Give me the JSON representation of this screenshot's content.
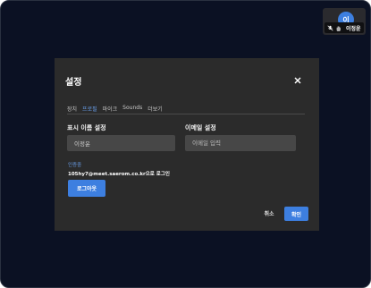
{
  "participant": {
    "initials": "이",
    "name": "이정윤",
    "mic_icon": "mic-muted-icon",
    "hand_icon": "raise-hand-icon"
  },
  "dialog": {
    "title": "설정",
    "close_icon": "close-icon",
    "tabs": [
      {
        "label": "장치",
        "active": false
      },
      {
        "label": "프로필",
        "active": true
      },
      {
        "label": "마이크",
        "active": false
      },
      {
        "label": "Sounds",
        "active": false
      },
      {
        "label": "더보기",
        "active": false
      }
    ],
    "display_name": {
      "label": "표시 이름 설정",
      "value": "이정윤"
    },
    "email": {
      "label": "이메일 설정",
      "placeholder": "이메일 입력"
    },
    "auth": {
      "status": "인증중",
      "account": "105hy7@meet.saerom.co.kr으로 로그인",
      "logout_label": "로그아웃"
    },
    "cancel_label": "취소",
    "ok_label": "확인"
  },
  "colors": {
    "accent": "#3d7fe0",
    "background": "#0b1123",
    "dialog": "#2b2b2b",
    "tab_active": "#6a9fe9"
  }
}
